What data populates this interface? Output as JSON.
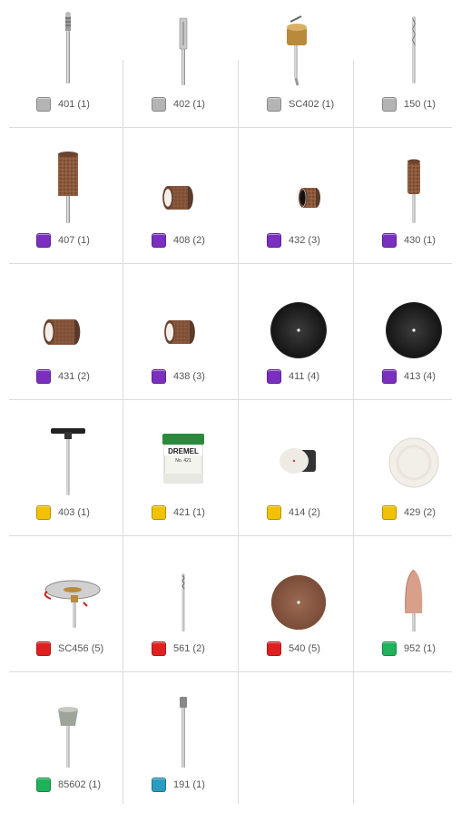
{
  "colors": {
    "grey": "#b4b4b4",
    "purple": "#7a2fbf",
    "yellow": "#f2c200",
    "red": "#e02020",
    "green": "#1eb25a",
    "teal": "#2a9cc0",
    "grid_line": "#dcdcdc",
    "label_text": "#555555"
  },
  "items": [
    {
      "label": "401 (1)",
      "color": "grey",
      "icon": "mandrel-screw-icon"
    },
    {
      "label": "402 (1)",
      "color": "grey",
      "icon": "mandrel-plain-icon"
    },
    {
      "label": "SC402 (1)",
      "color": "grey",
      "icon": "speedclic-mandrel-icon"
    },
    {
      "label": "150 (1)",
      "color": "grey",
      "icon": "drill-bit-icon"
    },
    {
      "label": "407 (1)",
      "color": "purple",
      "icon": "sanding-drum-icon"
    },
    {
      "label": "408 (2)",
      "color": "purple",
      "icon": "sanding-band-coarse-icon"
    },
    {
      "label": "432 (3)",
      "color": "purple",
      "icon": "sanding-band-small-icon"
    },
    {
      "label": "430 (1)",
      "color": "purple",
      "icon": "sanding-drum-small-icon"
    },
    {
      "label": "431 (2)",
      "color": "purple",
      "icon": "sanding-band-fine-icon"
    },
    {
      "label": "438 (3)",
      "color": "purple",
      "icon": "sanding-band-medium-icon"
    },
    {
      "label": "411 (4)",
      "color": "purple",
      "icon": "sanding-disc-icon"
    },
    {
      "label": "413 (4)",
      "color": "purple",
      "icon": "sanding-disc-large-icon"
    },
    {
      "label": "403 (1)",
      "color": "yellow",
      "icon": "t-mandrel-icon"
    },
    {
      "label": "421 (1)",
      "color": "yellow",
      "icon": "polishing-compound-icon",
      "jar_brand": "DREMEL",
      "jar_number": "No. 421"
    },
    {
      "label": "414 (2)",
      "color": "yellow",
      "icon": "felt-polishing-wheel-icon"
    },
    {
      "label": "429 (2)",
      "color": "yellow",
      "icon": "felt-polishing-disc-icon"
    },
    {
      "label": "SC456 (5)",
      "color": "red",
      "icon": "speedclic-cutting-wheel-icon"
    },
    {
      "label": "561 (2)",
      "color": "red",
      "icon": "cutting-bit-icon"
    },
    {
      "label": "540 (5)",
      "color": "red",
      "icon": "cut-off-wheel-icon"
    },
    {
      "label": "952 (1)",
      "color": "green",
      "icon": "grinding-stone-icon"
    },
    {
      "label": "85602 (1)",
      "color": "green",
      "icon": "sharpening-stone-icon"
    },
    {
      "label": "191 (1)",
      "color": "teal",
      "icon": "router-bit-icon"
    }
  ]
}
